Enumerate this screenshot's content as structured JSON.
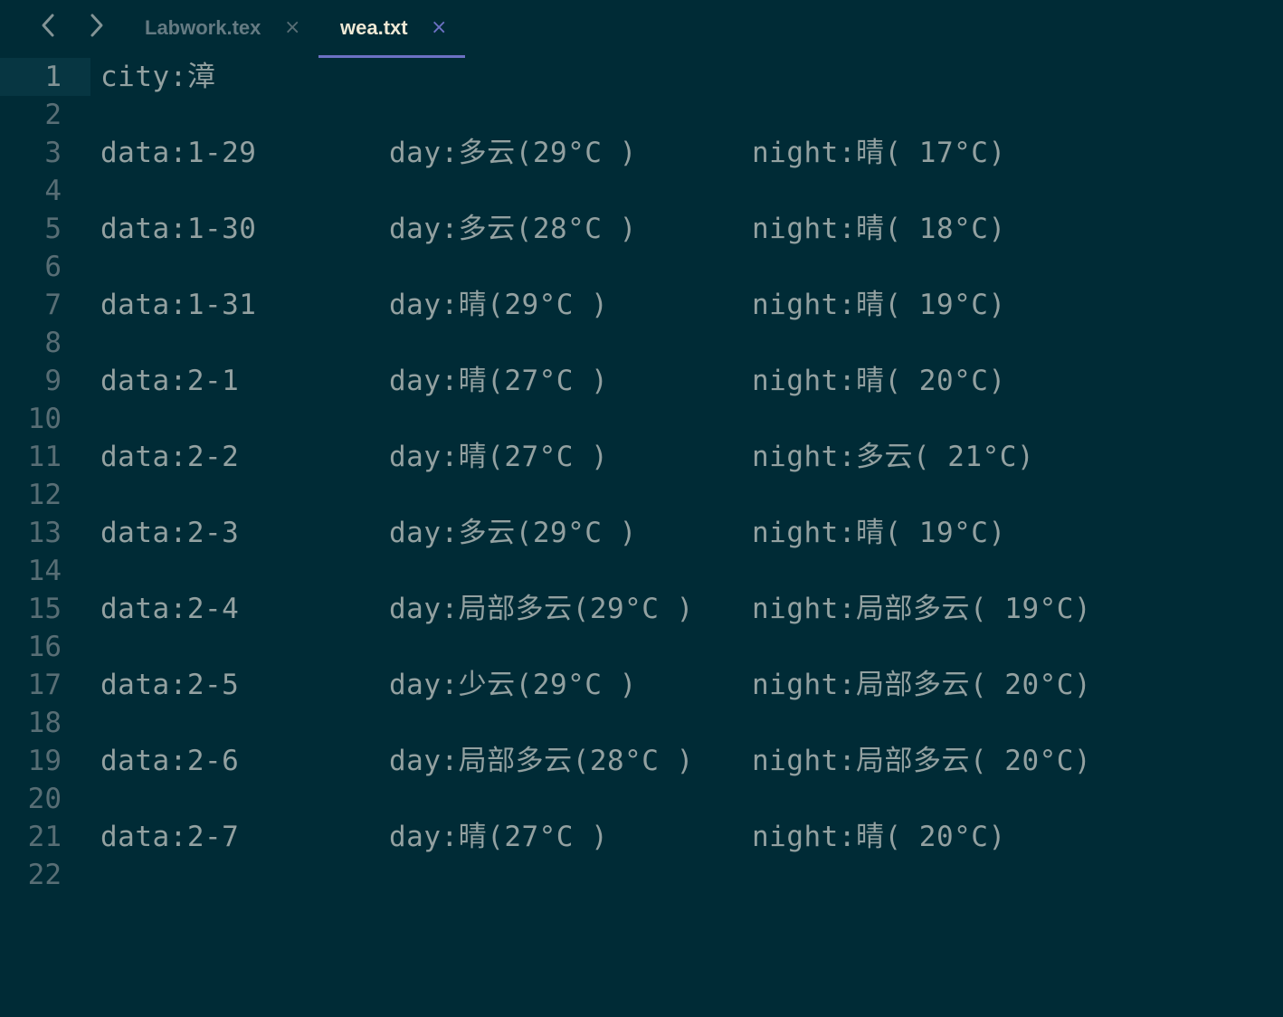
{
  "nav": {
    "back_icon": "chevron-left-icon",
    "forward_icon": "chevron-right-icon"
  },
  "tabs": [
    {
      "label": "Labwork.tex",
      "close": "×",
      "active": false
    },
    {
      "label": "wea.txt",
      "close": "×",
      "active": true
    }
  ],
  "colors": {
    "background": "#002b36",
    "current_line_gutter": "#073642",
    "text": "#93a1a1",
    "line_number": "#586e75",
    "active_tab_accent": "#6c71c4"
  },
  "editor": {
    "lines": [
      {
        "n": "1",
        "a": "city:漳",
        "b": "",
        "c": ""
      },
      {
        "n": "2",
        "a": "",
        "b": "",
        "c": ""
      },
      {
        "n": "3",
        "a": "data:1-29",
        "b": "day:多云(29°C )",
        "c": "night:晴( 17°C)"
      },
      {
        "n": "4",
        "a": "",
        "b": "",
        "c": ""
      },
      {
        "n": "5",
        "a": "data:1-30",
        "b": "day:多云(28°C )",
        "c": "night:晴( 18°C)"
      },
      {
        "n": "6",
        "a": "",
        "b": "",
        "c": ""
      },
      {
        "n": "7",
        "a": "data:1-31",
        "b": "day:晴(29°C )",
        "c": "night:晴( 19°C)"
      },
      {
        "n": "8",
        "a": "",
        "b": "",
        "c": ""
      },
      {
        "n": "9",
        "a": "data:2-1",
        "b": "day:晴(27°C )",
        "c": "night:晴( 20°C)"
      },
      {
        "n": "10",
        "a": "",
        "b": "",
        "c": ""
      },
      {
        "n": "11",
        "a": "data:2-2",
        "b": "day:晴(27°C )",
        "c": "night:多云( 21°C)"
      },
      {
        "n": "12",
        "a": "",
        "b": "",
        "c": ""
      },
      {
        "n": "13",
        "a": "data:2-3",
        "b": "day:多云(29°C )",
        "c": "night:晴( 19°C)"
      },
      {
        "n": "14",
        "a": "",
        "b": "",
        "c": ""
      },
      {
        "n": "15",
        "a": "data:2-4",
        "b": "day:局部多云(29°C )",
        "c": "night:局部多云( 19°C)"
      },
      {
        "n": "16",
        "a": "",
        "b": "",
        "c": ""
      },
      {
        "n": "17",
        "a": "data:2-5",
        "b": "day:少云(29°C )",
        "c": "night:局部多云( 20°C)"
      },
      {
        "n": "18",
        "a": "",
        "b": "",
        "c": ""
      },
      {
        "n": "19",
        "a": "data:2-6",
        "b": "day:局部多云(28°C )",
        "c": "night:局部多云( 20°C)"
      },
      {
        "n": "20",
        "a": "",
        "b": "",
        "c": ""
      },
      {
        "n": "21",
        "a": "data:2-7",
        "b": "day:晴(27°C )",
        "c": "night:晴( 20°C)"
      },
      {
        "n": "22",
        "a": "",
        "b": "",
        "c": ""
      }
    ]
  }
}
